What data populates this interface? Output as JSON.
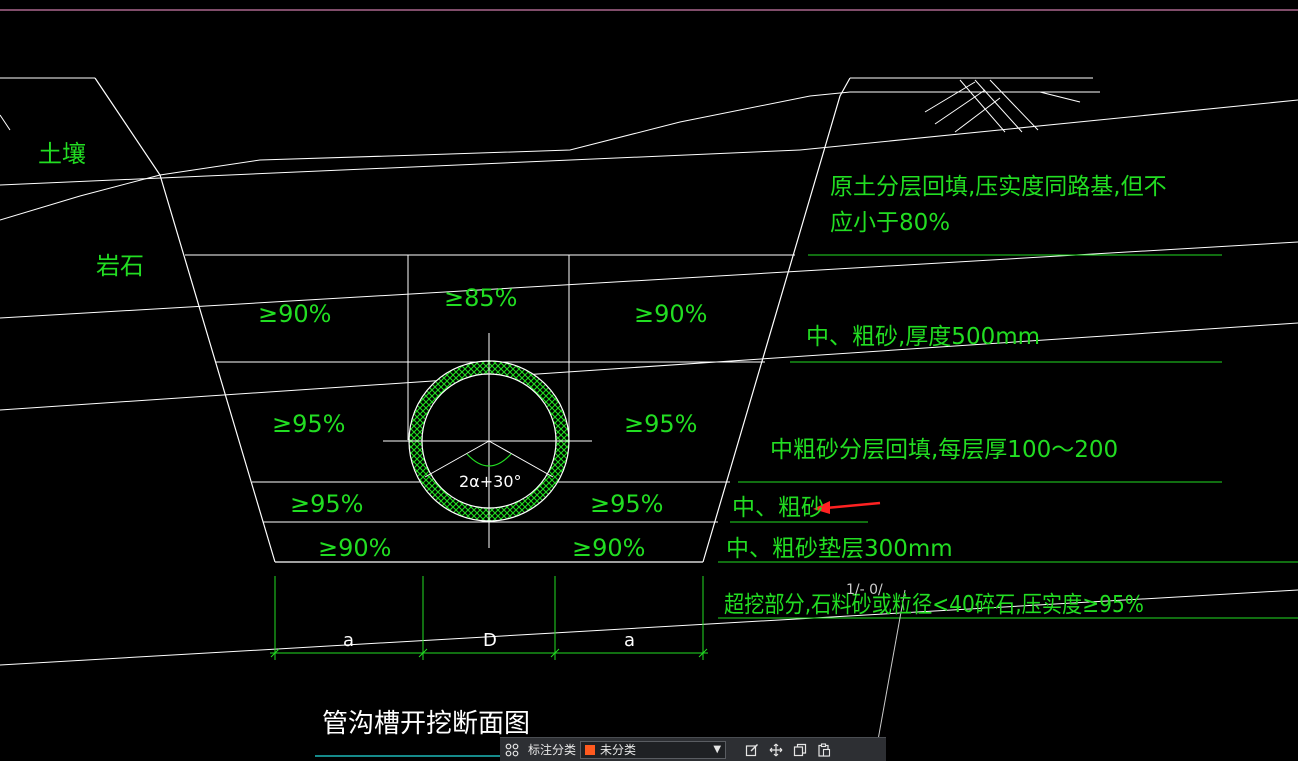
{
  "drawing": {
    "labels": {
      "soil": "土壤",
      "rock": "岩石",
      "note_backfill_1": "原土分层回填,压实度同路基,但不",
      "note_backfill_2": "应小于80%",
      "note_sand_500": "中、粗砂,厚度500mm",
      "note_sand_layer": "中粗砂分层回填,每层厚100～200",
      "note_sand": "中、粗砂",
      "note_cushion": "中、粗砂垫层300mm",
      "note_overdig": "超挖部分,石料砂或粒径<40碎石,压实度≥95%",
      "overlap_mark": "1/- 0/",
      "pct_top_left": "≥90%",
      "pct_top_mid": "≥85%",
      "pct_top_right": "≥90%",
      "pct_mid_left": "≥95%",
      "pct_mid_right": "≥95%",
      "pct_low_left": "≥95%",
      "pct_low_right": "≥95%",
      "pct_bot_left": "≥90%",
      "pct_bot_right": "≥90%",
      "angle": "2α+30°",
      "dim_a_left": "a",
      "dim_d": "D",
      "dim_a_right": "a",
      "title": "管沟槽开挖断面图"
    },
    "colors": {
      "lines": "#ffffff",
      "text": "#22dd22",
      "arrow": "#ff2222",
      "frame": "#ff9ad5"
    }
  },
  "toolbar": {
    "grid_icon": "grid-icon",
    "label": "标注分类",
    "select_value": "未分类",
    "select_color": "#ff5a1f",
    "icons": [
      "edit-icon",
      "move-icon",
      "copy-icon",
      "paste-icon"
    ]
  }
}
